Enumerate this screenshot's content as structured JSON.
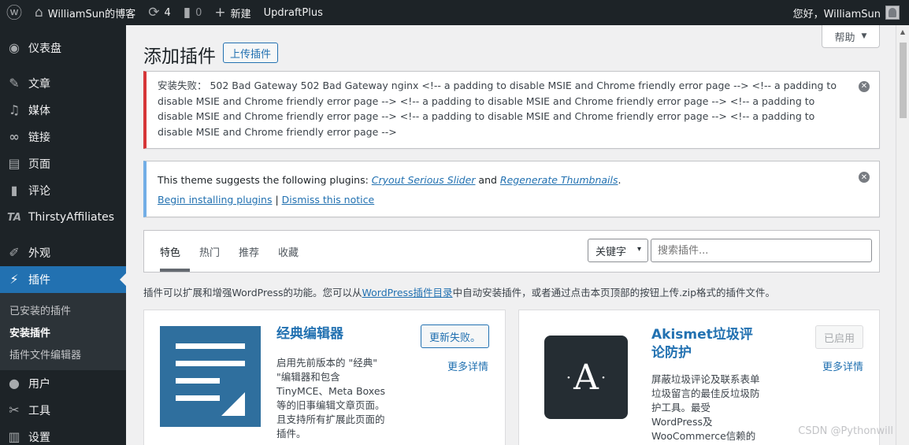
{
  "adminbar": {
    "site_name": "WilliamSun的博客",
    "updates_count": "4",
    "comments_count": "0",
    "new_label": "新建",
    "plugin_label": "UpdraftPlus",
    "greeting": "您好，WilliamSun"
  },
  "sidebar": {
    "items": [
      {
        "label": "仪表盘",
        "icon": "dashboard-icon"
      },
      {
        "label": "文章",
        "icon": "pin-icon"
      },
      {
        "label": "媒体",
        "icon": "media-icon"
      },
      {
        "label": "链接",
        "icon": "link-icon"
      },
      {
        "label": "页面",
        "icon": "page-icon"
      },
      {
        "label": "评论",
        "icon": "comment-icon"
      },
      {
        "label": "ThirstyAffiliates",
        "icon": "ta-icon"
      },
      {
        "label": "外观",
        "icon": "appearance-icon"
      },
      {
        "label": "插件",
        "icon": "plugins-icon"
      },
      {
        "label": "用户",
        "icon": "users-icon"
      },
      {
        "label": "工具",
        "icon": "tools-icon"
      },
      {
        "label": "设置",
        "icon": "settings-icon"
      }
    ],
    "submenu": [
      "已安装的插件",
      "安装插件",
      "插件文件编辑器"
    ]
  },
  "help_tab": "帮助",
  "page": {
    "title": "添加插件",
    "upload_button": "上传插件"
  },
  "error_notice": {
    "text": "安装失败： 502 Bad Gateway 502 Bad Gateway nginx <!-- a padding to disable MSIE and Chrome friendly error page --> <!-- a padding to disable MSIE and Chrome friendly error page --> <!-- a padding to disable MSIE and Chrome friendly error page --> <!-- a padding to disable MSIE and Chrome friendly error page --> <!-- a padding to disable MSIE and Chrome friendly error page --> <!-- a padding to disable MSIE and Chrome friendly error page -->"
  },
  "theme_notice": {
    "intro": "This theme suggests the following plugins: ",
    "plugin1": "Cryout Serious Slider",
    "and": " and ",
    "plugin2": "Regenerate Thumbnails",
    "period": ".",
    "begin_link": "Begin installing plugins",
    "separator": " | ",
    "dismiss_link": "Dismiss this notice"
  },
  "filter": {
    "tabs": [
      "特色",
      "热门",
      "推荐",
      "收藏"
    ],
    "select_value": "关键字",
    "search_placeholder": "搜索插件..."
  },
  "intro": {
    "before": "插件可以扩展和增强WordPress的功能。您可以从",
    "link": "WordPress插件目录",
    "after": "中自动安装插件，或者通过点击本页顶部的按钮上传.zip格式的插件文件。"
  },
  "cards": [
    {
      "name": "经典编辑器",
      "action": "更新失败。",
      "more": "更多详情",
      "desc": "启用先前版本的 \"经典\" \"编辑器和包含 TinyMCE、Meta Boxes 等的旧事编辑文章页面。且支持所有扩展此页面的插件。"
    },
    {
      "name": "Akismet垃圾评论防护",
      "action": "已启用",
      "more": "更多详情",
      "desc": "屏蔽垃圾评论及联系表单垃圾留言的最佳反垃圾防护工具。最受WordPress及WooCommerce信赖的反"
    }
  ],
  "watermark": "CSDN @Pythonwill",
  "colors": {
    "accent": "#2271b1",
    "error_border": "#d63638",
    "info_border": "#72aee6",
    "sidebar_bg": "#1d2327"
  }
}
